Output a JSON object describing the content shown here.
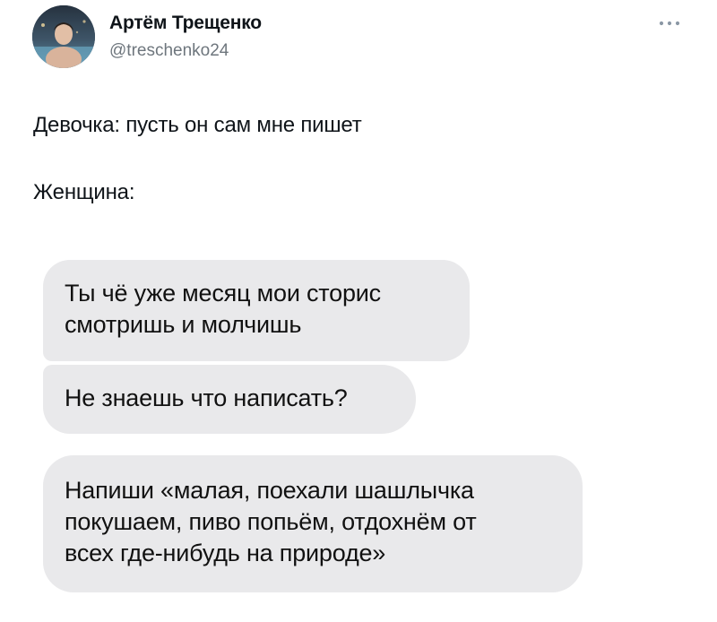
{
  "post": {
    "author": {
      "display_name": "Артём Трещенко",
      "handle": "@treschenko24",
      "avatar_icon": "profile-photo"
    },
    "menu_icon": "more-options-icon",
    "text_lines": [
      "Девочка: пусть он сам мне пишет",
      "Женщина:"
    ]
  },
  "messages": [
    {
      "lines": [
        "Ты чё уже месяц мои сторис",
        "смотришь и молчишь"
      ]
    },
    {
      "lines": [
        "Не знаешь что написать?"
      ]
    },
    {
      "lines": [
        "Напиши «малая, поехали шашлычка",
        "покушаем, пиво попьём, отдохнём от",
        "всех где-нибудь на природе»"
      ]
    }
  ],
  "colors": {
    "text": "#0f1419",
    "secondary_text": "#6e767d",
    "bubble": "#e9e9eb"
  }
}
